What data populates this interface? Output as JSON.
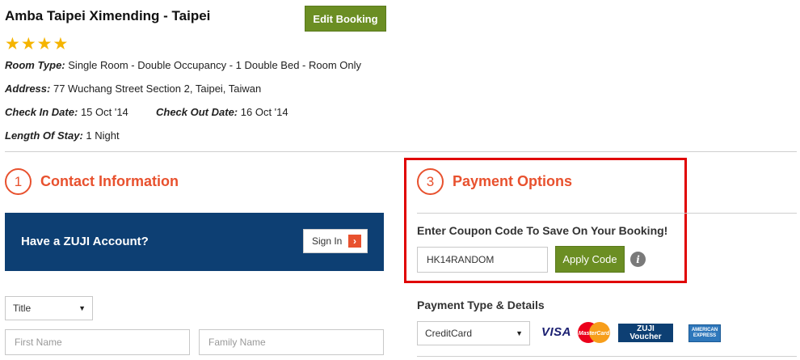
{
  "hotel": {
    "name": "Amba Taipei Ximending - Taipei",
    "stars": "★★★★",
    "room_type_label": "Room Type:",
    "room_type_value": "Single Room - Double Occupancy - 1 Double Bed - Room Only",
    "address_label": "Address:",
    "address_value": "77 Wuchang Street Section 2, Taipei, Taiwan",
    "check_in_label": "Check In Date:",
    "check_in_value": "15 Oct '14",
    "check_out_label": "Check Out Date:",
    "check_out_value": "16 Oct '14",
    "stay_label": "Length Of Stay:",
    "stay_value": "1 Night"
  },
  "edit_booking_label": "Edit Booking",
  "contact": {
    "step_number": "1",
    "title": "Contact Information",
    "account_prompt": "Have a ZUJI Account?",
    "sign_in_label": "Sign In",
    "sign_in_arrow": "›",
    "title_select_value": "Title",
    "first_name_placeholder": "First Name",
    "family_name_placeholder": "Family Name"
  },
  "payment": {
    "step_number": "3",
    "title": "Payment Options",
    "coupon_label": "Enter Coupon Code To Save On Your Booking!",
    "coupon_value": "HK14RANDOM",
    "apply_label": "Apply Code",
    "info_glyph": "i",
    "type_label": "Payment Type & Details",
    "type_select_value": "CreditCard",
    "cards": {
      "visa": "VISA",
      "mastercard": "MasterCard",
      "zuji_line1": "ZUJI",
      "zuji_line2": "Voucher",
      "amex_line1": "AMERICAN",
      "amex_line2": "EXPRESS"
    }
  },
  "colors": {
    "accent_orange": "#e8512e",
    "button_green": "#6b8e23",
    "zuji_blue": "#0d3f73",
    "highlight_red": "#e00000",
    "star_gold": "#f5b400"
  }
}
